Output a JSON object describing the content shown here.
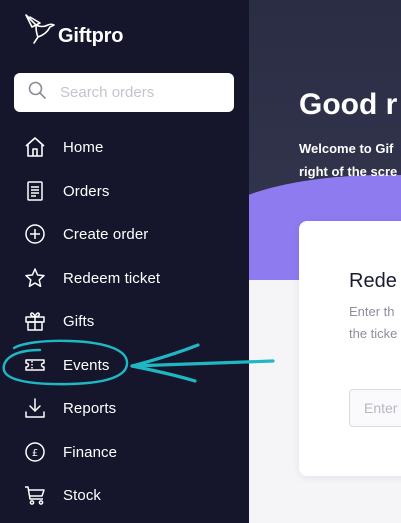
{
  "brand": {
    "name": "Giftpro",
    "logo_icon": "hummingbird-icon"
  },
  "search": {
    "placeholder": "Search orders",
    "value": "",
    "icon": "search-icon"
  },
  "sidebar": {
    "items": [
      {
        "label": "Home",
        "icon": "home-icon"
      },
      {
        "label": "Orders",
        "icon": "receipt-icon"
      },
      {
        "label": "Create order",
        "icon": "plus-circle-icon"
      },
      {
        "label": "Redeem ticket",
        "icon": "star-icon"
      },
      {
        "label": "Gifts",
        "icon": "gift-icon"
      },
      {
        "label": "Events",
        "icon": "ticket-icon"
      },
      {
        "label": "Reports",
        "icon": "download-icon"
      },
      {
        "label": "Finance",
        "icon": "pound-circle-icon"
      },
      {
        "label": "Stock",
        "icon": "cart-icon"
      }
    ]
  },
  "main": {
    "greeting": "Good r",
    "welcome_line1": "Welcome to Gif",
    "welcome_line2": "right of the scre",
    "card": {
      "title": "Rede",
      "desc_line1": "Enter th",
      "desc_line2": "the ticke",
      "input_placeholder": "Enter"
    }
  },
  "annotation": {
    "highlight": "Events",
    "color": "#1fb7c4"
  },
  "colors": {
    "sidebar_bg": "#15162b",
    "hero_bg": "#2a2d44",
    "accent_purple": "#8e7bf0",
    "annotation_teal": "#1fb7c4"
  }
}
